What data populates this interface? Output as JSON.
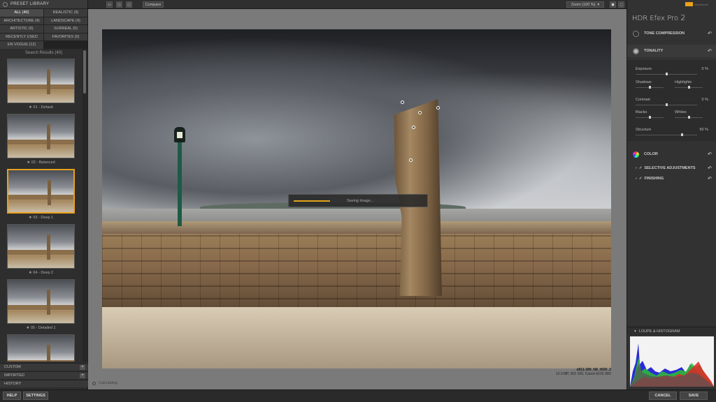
{
  "left_panel": {
    "header": "PRESET LIBRARY",
    "categories": [
      {
        "label": "ALL (40)",
        "selected": true
      },
      {
        "label": "REALISTIC (9)",
        "selected": false
      },
      {
        "label": "ARCHITECTURE (4)",
        "selected": false
      },
      {
        "label": "LANDSCAPE (4)",
        "selected": false
      },
      {
        "label": "ARTISTIC (6)",
        "selected": false
      },
      {
        "label": "SURREAL (5)",
        "selected": false
      },
      {
        "label": "RECENTLY USED",
        "selected": false
      },
      {
        "label": "FAVORITES (0)",
        "selected": false
      },
      {
        "label": "EN VOGUE (12)",
        "selected": false
      }
    ],
    "search_results": "Search Results (40)",
    "presets": [
      {
        "label": "★ 01 - Default",
        "selected": false
      },
      {
        "label": "★ 02 - Balanced",
        "selected": false
      },
      {
        "label": "★ 03 - Deep 1",
        "selected": true
      },
      {
        "label": "★ 04 - Deep 2",
        "selected": false
      },
      {
        "label": "★ 05 - Detailed 1",
        "selected": false
      },
      {
        "label": "",
        "selected": false
      }
    ],
    "sections": [
      {
        "label": "CUSTOM"
      },
      {
        "label": "IMPORTED"
      },
      {
        "label": "HISTORY"
      }
    ]
  },
  "toolbar": {
    "compare": "Compare",
    "zoom": "Zoom (100 %)"
  },
  "canvas": {
    "saving_text": "Saving Image...",
    "saving_progress": 0.26,
    "file_name": "d811-389_N8_HDR_2",
    "file_info": "12.3 MP, ISO 100, Canon EOS 30D",
    "status": "Calculating"
  },
  "right_panel": {
    "brand_text": "niksoftware",
    "app_title": "HDR Efex Pro",
    "app_version": "2",
    "reset_glyph": "↶",
    "sections": {
      "tone_compression": "TONE COMPRESSION",
      "tonality": "TONALITY",
      "color": "COLOR",
      "selective": "SELECTIVE ADJUSTMENTS",
      "finishing": "FINISHING"
    },
    "sliders": [
      {
        "label": "Exposure",
        "value": "0 %",
        "level": 0.5
      },
      {
        "label": "Shadows",
        "value": "",
        "level": 0.5
      },
      {
        "label": "Highlights",
        "value": "",
        "level": 0.5
      },
      {
        "label": "Contrast",
        "value": "0 %",
        "level": 0.5
      },
      {
        "label": "Blacks",
        "value": "",
        "level": 0.5
      },
      {
        "label": "Whites",
        "value": "",
        "level": 0.5
      },
      {
        "label": "Structure",
        "value": "50 %",
        "level": 0.75
      }
    ],
    "loupe_header": "LOUPE & HISTOGRAM"
  },
  "bottom_bar": {
    "help": "HELP",
    "settings": "SETTINGS",
    "cancel": "CANCEL",
    "save": "SAVE"
  },
  "colors": {
    "accent": "#e3a21c",
    "selected_border": "#e8a020"
  }
}
